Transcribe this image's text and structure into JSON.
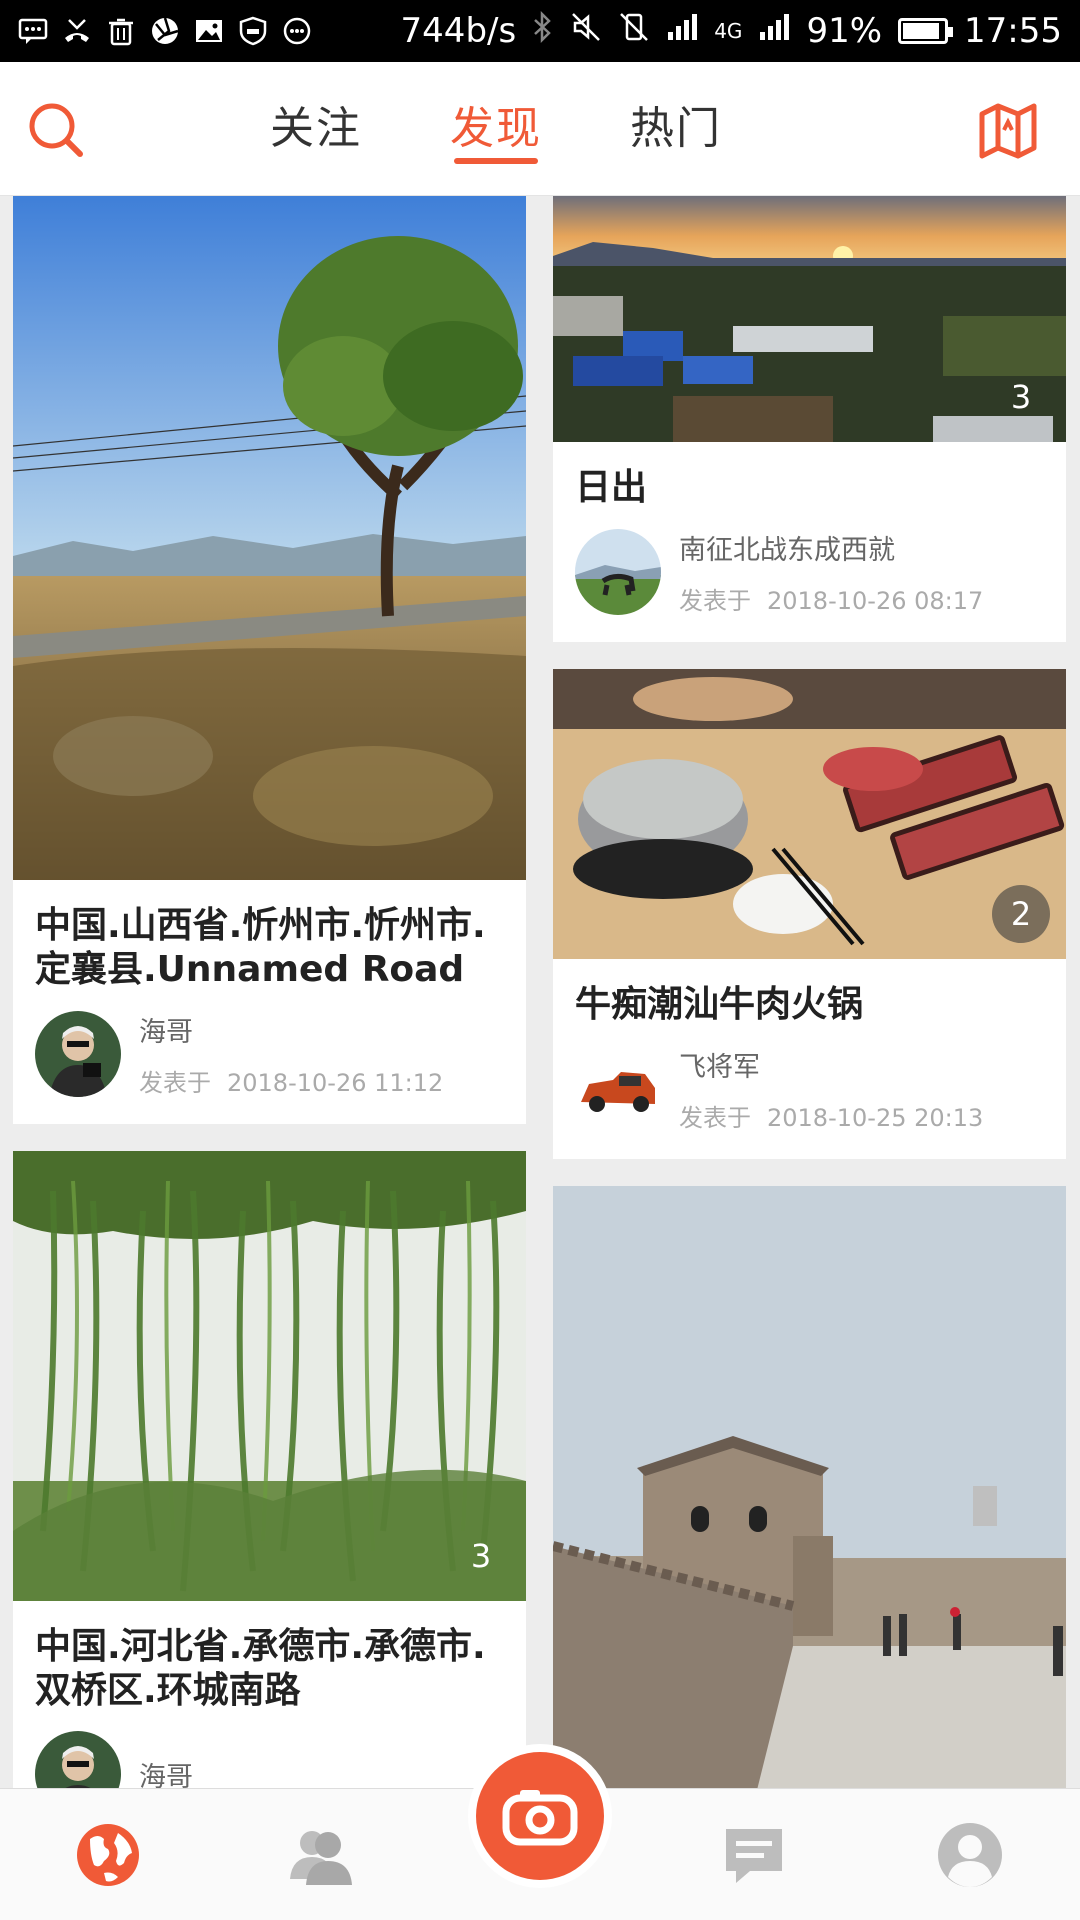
{
  "status_bar": {
    "speed": "744b/s",
    "network": "4G",
    "battery": "91%",
    "battery_level": 0.91,
    "time": "17:55"
  },
  "top_nav": {
    "tabs": [
      {
        "label": "关注",
        "active": false
      },
      {
        "label": "发现",
        "active": true
      },
      {
        "label": "热门",
        "active": false
      }
    ],
    "accent_color": "#f05a37"
  },
  "posts": [
    {
      "title": "中国.山西省.忻州市.忻州市.定襄县.Unnamed Road",
      "author": "海哥",
      "posted_prefix": "发表于",
      "posted_time": "2018-10-26 11:12",
      "photo_count": "",
      "photo_icon": "tree-landscape-photo"
    },
    {
      "title": "日出",
      "author": "南征北战东成西就",
      "posted_prefix": "发表于",
      "posted_time": "2018-10-26 08:17",
      "photo_count": "3",
      "photo_icon": "sunrise-village-photo"
    },
    {
      "title": "牛痴潮汕牛肉火锅",
      "author": "飞将军",
      "posted_prefix": "发表于",
      "posted_time": "2018-10-25 20:13",
      "photo_count": "2",
      "photo_icon": "hotpot-photo"
    },
    {
      "title": "中国.河北省.承德市.承德市.双桥区.环城南路",
      "author": "海哥",
      "posted_prefix": "",
      "posted_time": "",
      "photo_count": "3",
      "photo_icon": "willow-photo"
    },
    {
      "title": "",
      "author": "",
      "posted_prefix": "",
      "posted_time": "",
      "photo_count": "",
      "photo_icon": "city-wall-photo"
    }
  ],
  "bottom_nav": {
    "items": [
      "globe-icon",
      "contacts-icon",
      "camera-icon",
      "message-icon",
      "profile-icon"
    ]
  }
}
